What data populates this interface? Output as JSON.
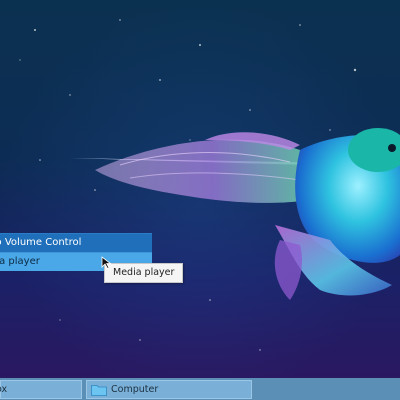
{
  "menu": {
    "items": [
      {
        "label": "lio Volume Control",
        "selected": false
      },
      {
        "label": "dia player",
        "selected": true
      }
    ]
  },
  "tooltip": {
    "text": "Media player"
  },
  "taskbar": {
    "buttons": [
      {
        "label": "ox",
        "icon": "app-icon"
      },
      {
        "label": "Computer",
        "icon": "folder-icon"
      }
    ]
  },
  "colors": {
    "menu_bg": "#1f6fba",
    "menu_selected": "#4aa8e8",
    "taskbar": "#5b8fb5",
    "taskbar_button": "#7ab0d8"
  }
}
